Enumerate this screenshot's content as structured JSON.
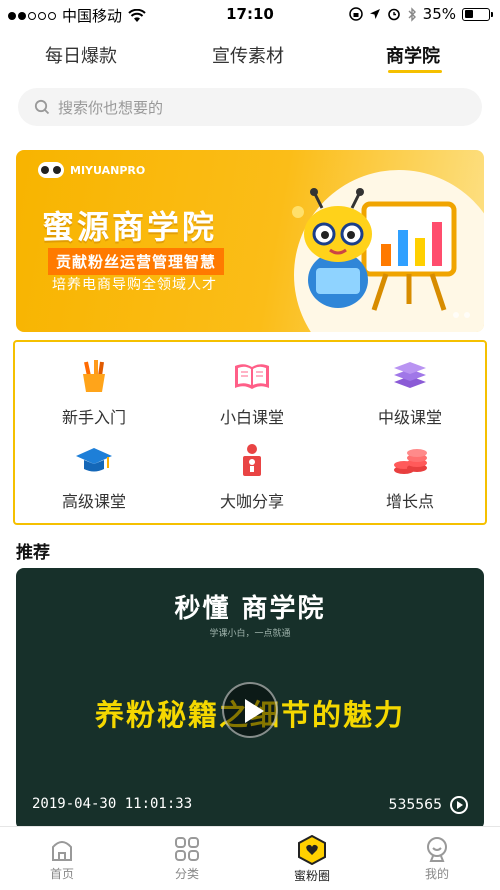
{
  "status_bar": {
    "carrier": "中国移动",
    "time": "17:10",
    "battery": "35%",
    "battery_level": 0.35
  },
  "tabs": [
    {
      "label": "每日爆款",
      "active": false
    },
    {
      "label": "宣传素材",
      "active": false
    },
    {
      "label": "商学院",
      "active": true
    }
  ],
  "search": {
    "placeholder": "搜索你也想要的",
    "icon": "search-icon"
  },
  "banner": {
    "logo_text": "MIYUANPRO",
    "title": "蜜源商学院",
    "subtitle": "贡献粉丝运营管理智慧",
    "tagline": "培养电商导购全领域人才"
  },
  "categories": [
    {
      "label": "新手入门",
      "icon": "pencil-cup-icon"
    },
    {
      "label": "小白课堂",
      "icon": "open-book-icon"
    },
    {
      "label": "中级课堂",
      "icon": "book-stack-icon"
    },
    {
      "label": "高级课堂",
      "icon": "graduation-cap-icon"
    },
    {
      "label": "大咖分享",
      "icon": "speaker-person-icon"
    },
    {
      "label": "增长点",
      "icon": "coin-stack-icon"
    }
  ],
  "section_title": "推荐",
  "video": {
    "brand": "秒懂 商学院",
    "slogan": "学课小白，一点就通",
    "headline": "养粉秘籍之细节的魅力",
    "date": "2019-04-30 11:01:33",
    "views": "535565"
  },
  "bottom_nav": [
    {
      "label": "首页",
      "icon": "home-icon",
      "active": false
    },
    {
      "label": "分类",
      "icon": "grid-icon",
      "active": false
    },
    {
      "label": "蜜粉圈",
      "icon": "hexagon-heart-icon",
      "active": true
    },
    {
      "label": "我的",
      "icon": "user-face-icon",
      "active": false
    }
  ],
  "colors": {
    "accent": "#f5c000",
    "banner": "#f8b400",
    "video_bg": "#17302a",
    "headline": "#f5d800"
  }
}
